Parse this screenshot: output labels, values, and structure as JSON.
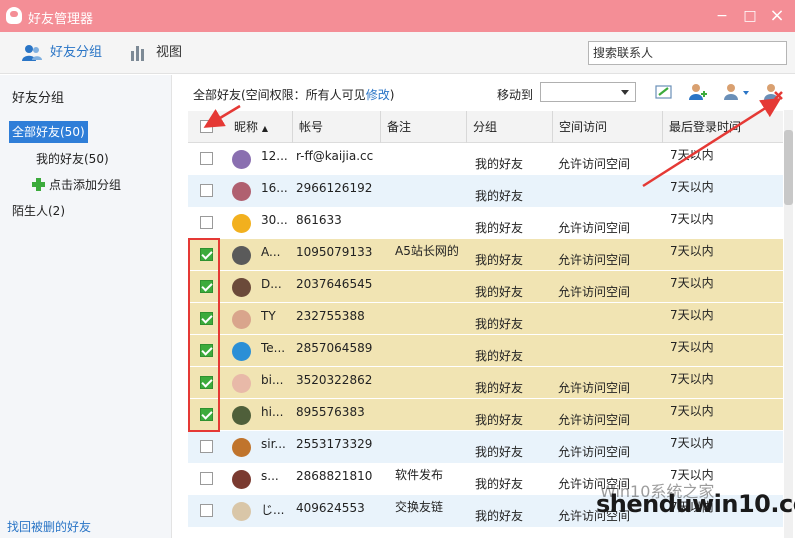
{
  "window": {
    "title": "好友管理器",
    "min": "−",
    "max": "□",
    "close": "×"
  },
  "toolbar": {
    "groups_label": "好友分组",
    "view_label": "视图",
    "search_placeholder": "搜索联系人"
  },
  "sidebar": {
    "title": "好友分组",
    "all_friends": "全部好友(50)",
    "my_friends": "我的好友(50)",
    "add_group": "点击添加分组",
    "strangers": "陌生人(2)",
    "recover": "找回被删的好友"
  },
  "main": {
    "info_prefix": "全部好友(空间权限：所有人可见",
    "info_link": "修改",
    "info_suffix": ")",
    "move_to": "移动到"
  },
  "columns": [
    "昵称",
    "帐号",
    "备注",
    "分组",
    "空间访问",
    "最后登录时间"
  ],
  "rows": [
    {
      "nick": "12...",
      "account": "r-ff@kaijia.cc",
      "note": "",
      "group": "我的好友",
      "space": "允许访问空间",
      "last": "7天以内",
      "checked": false,
      "alt": false,
      "avatar": "#8a6fb0"
    },
    {
      "nick": "16...",
      "account": "2966126192",
      "note": "",
      "group": "我的好友",
      "space": "",
      "last": "7天以内",
      "checked": false,
      "alt": true,
      "avatar": "#b06070"
    },
    {
      "nick": "30...",
      "account": "861633",
      "note": "",
      "group": "我的好友",
      "space": "允许访问空间",
      "last": "7天以内",
      "checked": false,
      "alt": false,
      "avatar": "#f2b01e"
    },
    {
      "nick": "A...",
      "account": "1095079133",
      "note": "A5站长网的",
      "group": "我的好友",
      "space": "允许访问空间",
      "last": "7天以内",
      "checked": true,
      "alt": false,
      "avatar": "#5a5a5a"
    },
    {
      "nick": "D...",
      "account": "2037646545",
      "note": "",
      "group": "我的好友",
      "space": "允许访问空间",
      "last": "7天以内",
      "checked": true,
      "alt": false,
      "avatar": "#6b4a3a"
    },
    {
      "nick": "TY",
      "account": "232755388",
      "note": "",
      "group": "我的好友",
      "space": "",
      "last": "7天以内",
      "checked": true,
      "alt": false,
      "avatar": "#d9a58c"
    },
    {
      "nick": "Te...",
      "account": "2857064589",
      "note": "",
      "group": "我的好友",
      "space": "",
      "last": "7天以内",
      "checked": true,
      "alt": false,
      "avatar": "#2b8fd6"
    },
    {
      "nick": "bi...",
      "account": "3520322862",
      "note": "",
      "group": "我的好友",
      "space": "允许访问空间",
      "last": "7天以内",
      "checked": true,
      "alt": false,
      "avatar": "#e8b9a8"
    },
    {
      "nick": "hi...",
      "account": "895576383",
      "note": "",
      "group": "我的好友",
      "space": "允许访问空间",
      "last": "7天以内",
      "checked": true,
      "alt": false,
      "avatar": "#4f5f3a"
    },
    {
      "nick": "sir...",
      "account": "2553173329",
      "note": "",
      "group": "我的好友",
      "space": "允许访问空间",
      "last": "7天以内",
      "checked": false,
      "alt": true,
      "avatar": "#c0742c"
    },
    {
      "nick": "s...",
      "account": "2868821810",
      "note": "软件发布",
      "group": "我的好友",
      "space": "允许访问空间",
      "last": "7天以内",
      "checked": false,
      "alt": false,
      "avatar": "#7a3a30"
    },
    {
      "nick": "じ...",
      "account": "409624553",
      "note": "交换友链",
      "group": "我的好友",
      "space": "允许访问空间",
      "last": "7天以内",
      "checked": false,
      "alt": true,
      "avatar": "#d9c6a8"
    }
  ],
  "watermark": "shenduwin10.com",
  "watermark_top": "Win10系统之家",
  "colors": {
    "title_bar": "#f48e96",
    "selected_row": "#f1e4b3",
    "alt_row": "#e9f3fb",
    "accent": "#2a75c6",
    "red_mark": "#e53935"
  }
}
